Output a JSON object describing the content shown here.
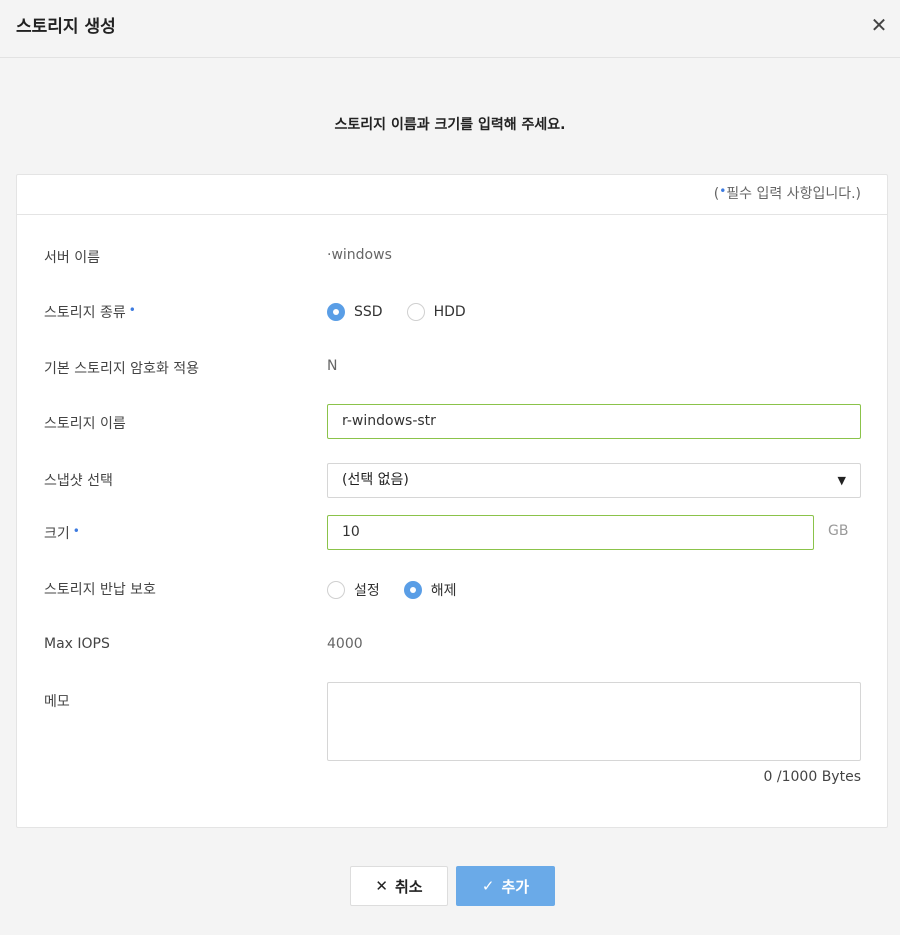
{
  "dialog": {
    "title": "스토리지 생성",
    "close_icon": "close-icon",
    "instruction": "스토리지 이름과 크기를 입력해 주세요."
  },
  "panel": {
    "required_note_open": "(",
    "required_note_text": "필수 입력 사항입니다.)",
    "required_dot": "•"
  },
  "form": {
    "server_name": {
      "label": "서버 이름",
      "value": "·windows"
    },
    "storage_type": {
      "label": "스토리지 종류",
      "options": [
        "SSD",
        "HDD"
      ],
      "selected": "SSD"
    },
    "encryption": {
      "label": "기본 스토리지 암호화 적용",
      "value": "N"
    },
    "storage_name": {
      "label": "스토리지 이름",
      "value": "r-windows-str"
    },
    "snapshot": {
      "label": "스냅샷 선택",
      "value": "(선택 없음)"
    },
    "size": {
      "label": "크기",
      "value": "10",
      "unit": "GB"
    },
    "return_protection": {
      "label": "스토리지 반납 보호",
      "options": [
        "설정",
        "해제"
      ],
      "selected": "해제"
    },
    "max_iops": {
      "label": "Max IOPS",
      "value": "4000"
    },
    "memo": {
      "label": "메모",
      "value": "",
      "counter": "0 /1000 Bytes"
    }
  },
  "buttons": {
    "cancel": {
      "icon": "✕",
      "label": "취소"
    },
    "add": {
      "icon": "✓",
      "label": "추가"
    }
  },
  "colors": {
    "accent": "#5a9ee6",
    "valid_border": "#8bc34a",
    "required_dot": "#3d7be0"
  }
}
